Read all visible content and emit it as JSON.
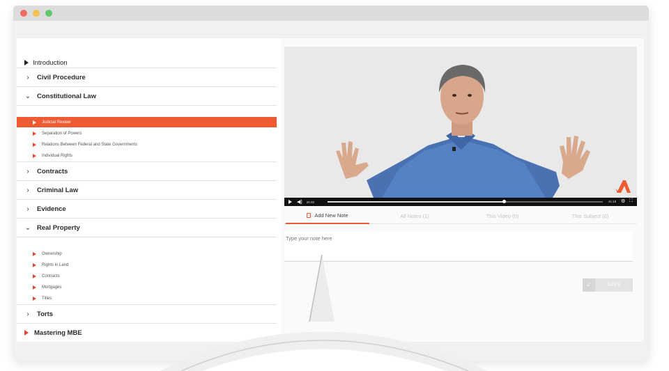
{
  "window": {
    "controls": [
      "close",
      "minimize",
      "zoom"
    ]
  },
  "sidebar": {
    "intro": "Introduction",
    "sections": [
      {
        "label": "Civil Procedure",
        "expanded": false
      },
      {
        "label": "Constitutional Law",
        "expanded": true
      },
      {
        "label": "Contracts",
        "expanded": false
      },
      {
        "label": "Criminal Law",
        "expanded": false
      },
      {
        "label": "Evidence",
        "expanded": false
      },
      {
        "label": "Real Property",
        "expanded": true
      },
      {
        "label": "Torts",
        "expanded": false
      }
    ],
    "constitutional_items": [
      "Judicial Review",
      "Separation of Powers",
      "Relations Between Federal and State Governments",
      "Individual Rights"
    ],
    "active_item": "Judicial Review",
    "real_property_items": [
      "Ownership",
      "Rights in Land",
      "Contracts",
      "Mortgages",
      "Titles"
    ],
    "mastering": "Mastering MBE"
  },
  "video": {
    "current_time": "26:32",
    "duration": "41:18",
    "progress": 0.64
  },
  "notes": {
    "tabs": [
      "Add New Note",
      "All Notes (1)",
      "This Video (0)",
      "This Subject (0)"
    ],
    "active_tab": "Add New Note",
    "placeholder": "Type your note here",
    "save_label": "SAVE"
  },
  "colors": {
    "accent": "#ee5a32",
    "play_icon": "#e8442e"
  }
}
